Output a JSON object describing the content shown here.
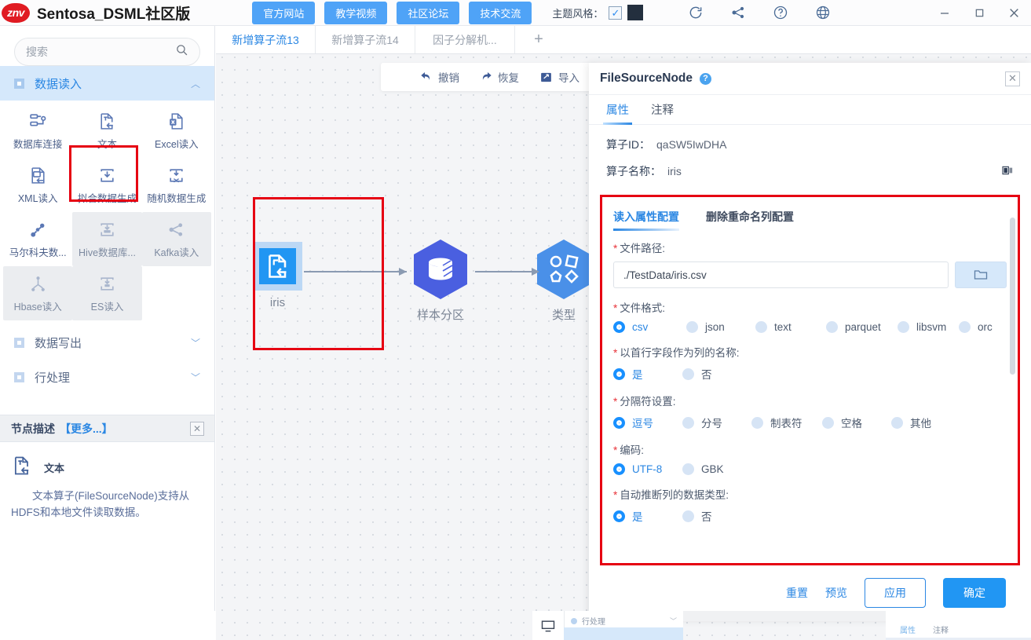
{
  "titlebar": {
    "logo_text": "znv",
    "app_title": "Sentosa_DSML社区版",
    "nav_buttons": [
      {
        "label": "官方网站",
        "name": "official-site-button"
      },
      {
        "label": "教学视频",
        "name": "tutorial-video-button"
      },
      {
        "label": "社区论坛",
        "name": "community-forum-button"
      },
      {
        "label": "技术交流",
        "name": "tech-exchange-button"
      }
    ],
    "theme_label": "主题风格：",
    "theme_checked": true,
    "theme_color": "#232f3e",
    "icons": [
      "refresh-icon",
      "share-nodes-icon",
      "help-circle-icon",
      "globe-icon"
    ],
    "window_controls": [
      "minimize",
      "maximize",
      "close"
    ]
  },
  "sidebar": {
    "search": {
      "placeholder": "搜索",
      "value": ""
    },
    "categories": [
      {
        "label": "数据读入",
        "expanded": true,
        "active": true
      },
      {
        "label": "数据写出",
        "expanded": false,
        "active": false
      },
      {
        "label": "行处理",
        "expanded": false,
        "active": false
      }
    ],
    "operators": [
      {
        "label": "数据库连接",
        "icon": "database-connect-icon",
        "disabled": false
      },
      {
        "label": "文本",
        "icon": "text-file-icon",
        "disabled": false,
        "selected": true
      },
      {
        "label": "Excel读入",
        "icon": "excel-file-icon",
        "disabled": false
      },
      {
        "label": "XML读入",
        "icon": "xml-file-icon",
        "disabled": false
      },
      {
        "label": "拟合数据生成",
        "icon": "fit-data-icon",
        "disabled": false
      },
      {
        "label": "随机数据生成",
        "icon": "random-data-icon",
        "disabled": false
      },
      {
        "label": "马尔科夫数...",
        "icon": "markov-data-icon",
        "disabled": false
      },
      {
        "label": "Hive数据库...",
        "icon": "hive-icon",
        "disabled": true
      },
      {
        "label": "Kafka读入",
        "icon": "kafka-icon",
        "disabled": true
      },
      {
        "label": "Hbase读入",
        "icon": "hbase-icon",
        "disabled": true
      },
      {
        "label": "ES读入",
        "icon": "es-icon",
        "disabled": true
      }
    ],
    "node_desc": {
      "title": "节点描述",
      "more": "【更多...】",
      "name": "文本",
      "text": "文本算子(FileSourceNode)支持从HDFS和本地文件读取数据。"
    }
  },
  "tabs": [
    {
      "label": "新增算子流13",
      "active": true
    },
    {
      "label": "新增算子流14",
      "active": false
    },
    {
      "label": "因子分解机...",
      "active": false
    },
    {
      "label": "+",
      "active": false
    }
  ],
  "canvas_toolbar": [
    {
      "label": "撤销",
      "icon": "undo-icon"
    },
    {
      "label": "恢复",
      "icon": "redo-icon"
    },
    {
      "label": "导入",
      "icon": "import-icon"
    }
  ],
  "canvas_nodes": [
    {
      "label": "iris",
      "icon": "text-file-icon",
      "shape": "square",
      "selected": true
    },
    {
      "label": "样本分区",
      "icon": "database-split-icon",
      "shape": "hexagon",
      "selected": false
    },
    {
      "label": "类型",
      "icon": "shapes-icon",
      "shape": "hexagon",
      "selected": false
    }
  ],
  "property_panel": {
    "title": "FileSourceNode",
    "help_glyph": "?",
    "tabs": [
      {
        "label": "属性",
        "active": true
      },
      {
        "label": "注释",
        "active": false
      }
    ],
    "operator_id_label": "算子ID：",
    "operator_id_value": "qaSW5IwDHA",
    "operator_name_label": "算子名称：",
    "operator_name_value": "iris",
    "config_tabs": [
      {
        "label": "读入属性配置",
        "active": true
      },
      {
        "label": "删除重命名列配置",
        "active": false
      }
    ],
    "fields": [
      {
        "name": "file-path",
        "label": "文件路径:",
        "required": true,
        "type": "path",
        "value": "./TestData/iris.csv",
        "browse_icon": "folder-icon"
      },
      {
        "name": "file-format",
        "label": "文件格式:",
        "required": true,
        "type": "radio",
        "options": [
          "csv",
          "json",
          "text",
          "parquet",
          "libsvm",
          "orc"
        ],
        "selected": "csv"
      },
      {
        "name": "first-row-as-header",
        "label": "以首行字段作为列的名称:",
        "required": true,
        "type": "radio",
        "options": [
          "是",
          "否"
        ],
        "selected": "是"
      },
      {
        "name": "delimiter",
        "label": "分隔符设置:",
        "required": true,
        "type": "radio",
        "options": [
          "逗号",
          "分号",
          "制表符",
          "空格",
          "其他"
        ],
        "selected": "逗号"
      },
      {
        "name": "encoding",
        "label": "编码:",
        "required": true,
        "type": "radio",
        "options": [
          "UTF-8",
          "GBK"
        ],
        "selected": "UTF-8"
      },
      {
        "name": "infer-schema",
        "label": "自动推断列的数据类型:",
        "required": true,
        "type": "radio",
        "options": [
          "是",
          "否"
        ],
        "selected": "是"
      }
    ],
    "footer": {
      "reset": "重置",
      "preview": "预览",
      "apply": "应用",
      "confirm": "确定"
    }
  },
  "background_window": {
    "item_label": "行处理",
    "tabs": [
      "属性",
      "注释"
    ]
  },
  "colors": {
    "accent": "#2196f3",
    "highlight_red": "#e60012",
    "sidebar_active": "#d5e8fb",
    "node_blue": "#4a7cf0"
  }
}
